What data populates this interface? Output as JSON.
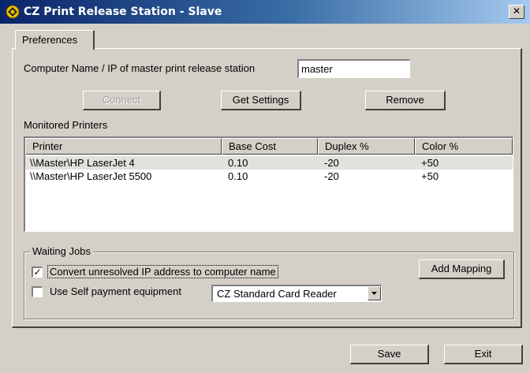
{
  "window": {
    "title": "CZ Print Release Station - Slave",
    "close_glyph": "✕"
  },
  "tabs": [
    {
      "label": "Preferences",
      "active": true
    }
  ],
  "master": {
    "label": "Computer Name / IP of master print release station",
    "value": "master"
  },
  "actions": {
    "connect": "Connect",
    "get_settings": "Get Settings",
    "remove": "Remove"
  },
  "monitored": {
    "label": "Monitored Printers",
    "columns": [
      "Printer",
      "Base Cost",
      "Duplex %",
      "Color %"
    ],
    "rows": [
      {
        "printer": "\\\\Master\\HP LaserJet 4",
        "base_cost": "0.10",
        "duplex": "-20",
        "color": "+50",
        "selected": true
      },
      {
        "printer": "\\\\Master\\HP LaserJet 5500",
        "base_cost": "0.10",
        "duplex": "-20",
        "color": "+50",
        "selected": false
      }
    ]
  },
  "waiting_jobs": {
    "title": "Waiting Jobs",
    "convert_label": "Convert unresolved IP address to computer name",
    "convert_checked": true,
    "check_glyph": "✓",
    "self_payment_label": "Use Self payment equipment",
    "self_payment_checked": false,
    "card_reader": "CZ Standard Card Reader",
    "add_mapping": "Add Mapping"
  },
  "footer": {
    "save": "Save",
    "exit": "Exit"
  },
  "colors": {
    "titlebar_start": "#0a246a",
    "titlebar_end": "#a6caf0",
    "face": "#d4d0c8"
  }
}
